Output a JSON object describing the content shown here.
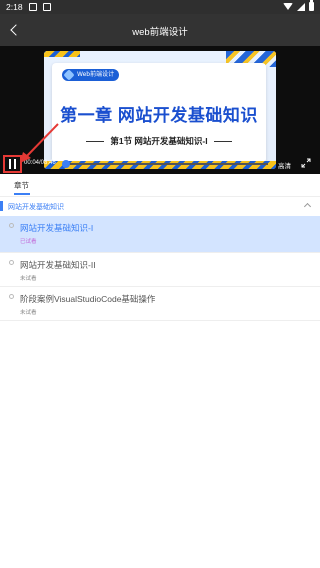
{
  "status_bar": {
    "time": "2:18"
  },
  "app_bar": {
    "title": "web前端设计"
  },
  "video": {
    "slide_badge": "Web前端设计",
    "slide_title": "第一章 网站开发基础知识",
    "slide_subtitle": "第1节 网站开发基础知识-I",
    "time_text": "00:04/08:46",
    "progress": 0.008,
    "quality_label": "高清"
  },
  "tabs": [
    {
      "label": "章节"
    }
  ],
  "chapter": {
    "title": "网站开发基础知识"
  },
  "lessons": [
    {
      "title": "网站开发基础知识-I",
      "status": "已试看"
    },
    {
      "title": "网站开发基础知识-II",
      "status": "未试看"
    },
    {
      "title": "阶段案例VisualStudioCode基础操作",
      "status": "未试看"
    }
  ],
  "colors": {
    "accent": "#3b7ff5",
    "annotation": "#e53935",
    "active_row": "#d3e4ff",
    "watched": "#c36ad8"
  }
}
